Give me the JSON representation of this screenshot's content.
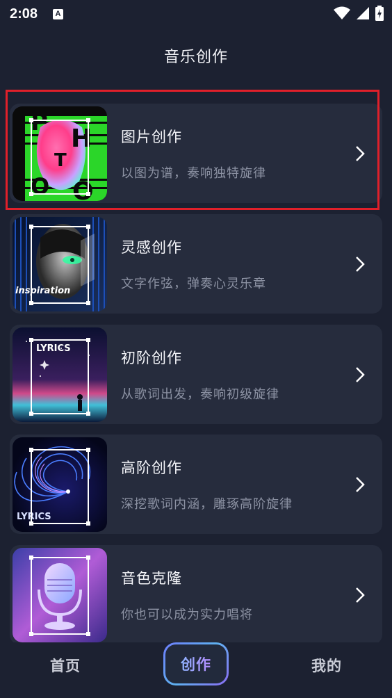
{
  "status_bar": {
    "time": "2:08",
    "notification_badge": "A"
  },
  "page_title": "音乐创作",
  "cards": [
    {
      "title": "图片创作",
      "subtitle": "以图为谱，奏响独特旋律",
      "thumb_letters": [
        "P",
        "H",
        "T",
        "O",
        "O"
      ],
      "icon": "photo-thumbnail"
    },
    {
      "title": "灵感创作",
      "subtitle": "文字作弦，弹奏心灵乐章",
      "thumb_text": "inspiration",
      "icon": "inspiration-thumbnail"
    },
    {
      "title": "初阶创作",
      "subtitle": "从歌词出发，奏响初级旋律",
      "thumb_text": "LYRICS",
      "icon": "lyrics-thumbnail"
    },
    {
      "title": "高阶创作",
      "subtitle": "深挖歌词内涵，雕琢高阶旋律",
      "thumb_text": "LYRICS",
      "icon": "swirl-thumbnail"
    },
    {
      "title": "音色克隆",
      "subtitle": "你也可以成为实力唱将",
      "icon": "microphone-thumbnail"
    }
  ],
  "bottom_nav": {
    "home": "首页",
    "create": "创作",
    "mine": "我的"
  },
  "colors": {
    "background": "#1c2131",
    "card": "#262c3d",
    "highlight": "#e0202a",
    "accent": "#6d7dfc"
  }
}
